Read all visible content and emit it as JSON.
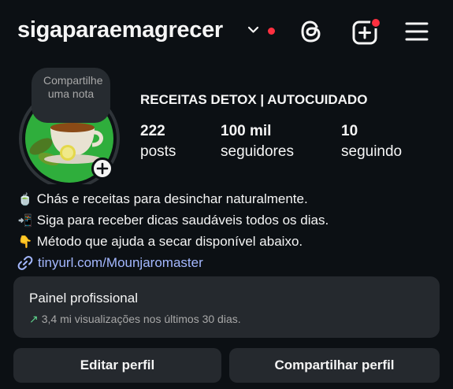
{
  "header": {
    "username": "sigaparaemagrecer",
    "chevron_icon": "chevron-down-icon",
    "threads_icon": "threads-icon",
    "new_post_icon": "add-square-icon",
    "menu_icon": "hamburger-menu-icon",
    "notification_color": "#ff3040"
  },
  "profile": {
    "note_label": "Compartilhe uma nota",
    "name": "RECEITAS DETOX | AUTOCUIDADO",
    "stats": [
      {
        "value": "222",
        "label": "posts"
      },
      {
        "value": "100 mil",
        "label": "seguidores"
      },
      {
        "value": "10",
        "label": "seguindo"
      }
    ]
  },
  "bio": {
    "lines": [
      {
        "emoji": "🍵",
        "text": "Chás e receitas para desinchar naturalmente."
      },
      {
        "emoji": "📲",
        "text": "Siga para receber dicas saudáveis todos os dias."
      },
      {
        "emoji": "👇",
        "text": "Método que ajuda a secar disponível abaixo."
      }
    ],
    "link": "tinyurl.com/Mounjaromaster",
    "link_color": "#a4b8ff"
  },
  "dashboard": {
    "title": "Painel profissional",
    "subtitle": "3,4 mi visualizações nos últimos 30 dias.",
    "trend_color": "#5fd38d"
  },
  "actions": {
    "edit": "Editar perfil",
    "share": "Compartilhar perfil"
  }
}
